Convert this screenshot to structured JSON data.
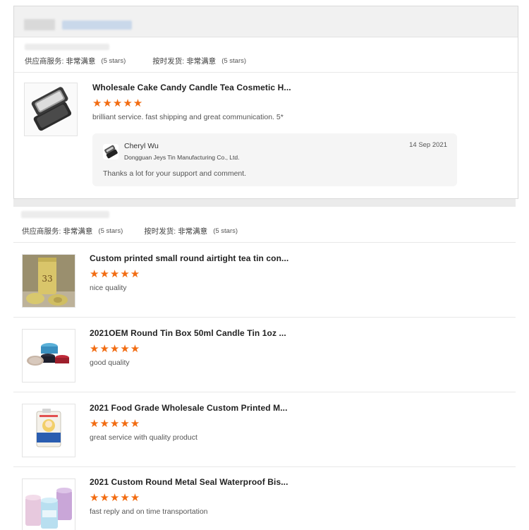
{
  "supplier_rating_label": "供应商服务:",
  "supplier_rating_value": "非常满意",
  "ontime_label": "按时发货:",
  "ontime_value": "非常满意",
  "stars_note": "(5 stars)",
  "star_glyphs": "★★★★★",
  "colors": {
    "star": "#f26c12",
    "reply_bg": "#f5f5f5"
  },
  "card1": {
    "product_title": "Wholesale Cake Candy Candle Tea Cosmetic H...",
    "review": "brilliant service. fast shipping and great communication. 5*",
    "reply": {
      "name": "Cheryl Wu",
      "company": "Dongguan Jeys Tin Manufacturing Co., Ltd.",
      "date": "14 Sep 2021",
      "text": "Thanks a lot for your support and comment."
    }
  },
  "card2": {
    "items": [
      {
        "title": "Custom printed small round airtight tea tin con...",
        "review": "nice quality"
      },
      {
        "title": "2021OEM Round Tin Box 50ml Candle Tin 1oz ...",
        "review": "good quality"
      },
      {
        "title": "2021 Food Grade Wholesale Custom Printed M...",
        "review": "great service with quality product"
      },
      {
        "title": "2021 Custom Round Metal Seal Waterproof Bis...",
        "review": "fast reply and on time transportation"
      }
    ]
  }
}
